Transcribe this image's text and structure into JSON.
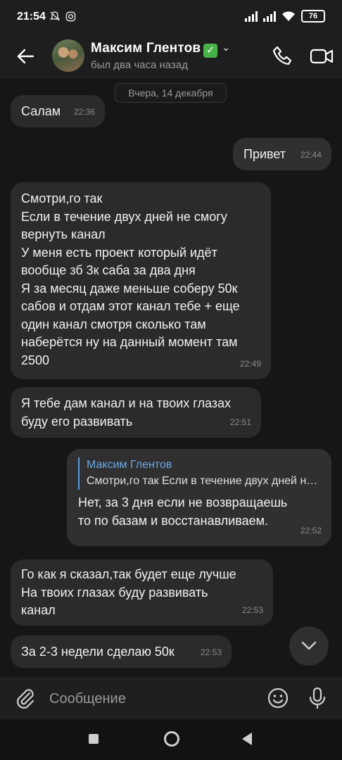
{
  "status_bar": {
    "time": "21:54",
    "battery": "76"
  },
  "header": {
    "contact_name": "Максим Глентов",
    "verified_mark": "✓",
    "last_seen": "был два часа назад"
  },
  "date_separator": "Вчера, 14 декабря",
  "messages": [
    {
      "direction": "in",
      "text": "Салам",
      "time": "22:36"
    },
    {
      "direction": "out",
      "text": "Привет",
      "time": "22:44"
    },
    {
      "direction": "in",
      "text": "Смотри,го так\nЕсли в течение двух дней не смогу\nвернуть канал\nУ меня есть проект который идёт\nвообще зб 3к саба за два дня\nЯ за месяц даже меньше соберу 50к\nсабов и отдам этот канал тебе + еще\nодин канал смотря сколько там\nнаберётся ну на данный момент там\n2500",
      "time": "22:49"
    },
    {
      "direction": "in",
      "text": "Я тебе дам канал и на твоих глазах\nбуду его развивать",
      "time": "22:51"
    },
    {
      "direction": "out",
      "reply_author": "Максим Глентов",
      "reply_text": "Смотри,го так  Если в течение двух дней не смогу вернуть канал",
      "text": "Нет, за 3 дня если не возвращаешь\nто по базам и восстанавливаем.",
      "time": "22:52"
    },
    {
      "direction": "in",
      "text": "Го как я сказал,так будет еще лучше\nНа твоих глазах буду развивать\nканал",
      "time": "22:53"
    },
    {
      "direction": "in",
      "text": "За 2-3 недели сделаю 50к",
      "time": "22:53"
    }
  ],
  "input": {
    "placeholder": "Сообщение"
  },
  "icons": {
    "back": "arrow-left-icon",
    "call": "phone-icon",
    "video": "video-camera-icon",
    "attach": "paperclip-icon",
    "emoji": "smiley-icon",
    "mic": "microphone-icon",
    "scroll": "chevron-down-icon"
  },
  "colors": {
    "background": "#161616",
    "bubble_in": "#2b2b2b",
    "bubble_out": "#303030",
    "reply_accent": "#6aa8e8",
    "verified": "#46b34a"
  }
}
